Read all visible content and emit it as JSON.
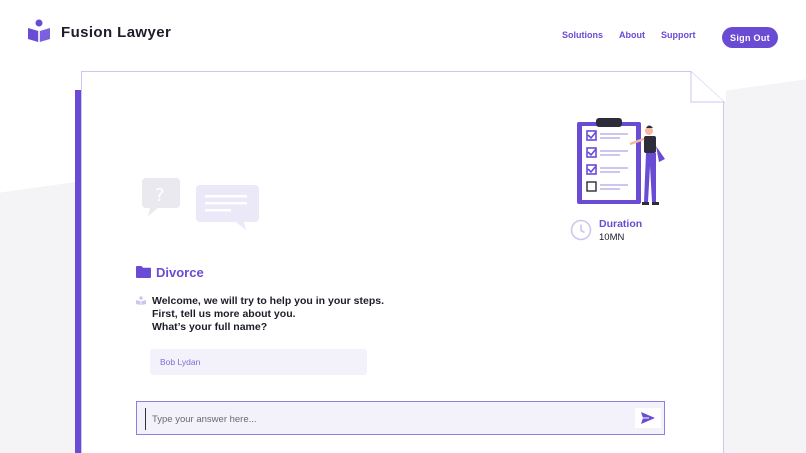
{
  "brand": {
    "name": "Fusion Lawyer",
    "logo_icon": "reading-person-icon",
    "accent_color": "#6a4bd3"
  },
  "nav": {
    "items": [
      "Solutions",
      "About",
      "Support"
    ],
    "signout_label": "Sign Out"
  },
  "card": {
    "duration": {
      "label": "Duration",
      "value": "10MN",
      "icon": "clock-icon"
    },
    "category": {
      "icon": "folder-icon",
      "title": "Divorce"
    },
    "bot_message": {
      "lines": [
        "Welcome, we will try to help you in your steps.",
        "First, tell us more about you.",
        "What’s your full name?"
      ]
    },
    "user_answer": "Bob Lydan",
    "input": {
      "placeholder": "Type your answer here...",
      "send_icon": "send-icon"
    }
  }
}
